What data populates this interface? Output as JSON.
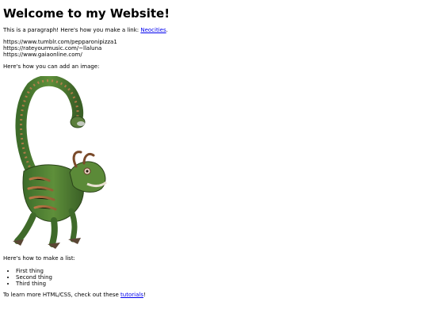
{
  "page": {
    "heading": "Welcome to my Website!",
    "link_intro": "This is a paragraph! Here's how you make a link: ",
    "link_text": "Neocities",
    "link_suffix": ".",
    "urls": [
      "https://www.tumblr.com/pepparonipizza1",
      "https://rateyourmusic.com/~llaluna",
      "https://www.gaiaonline.com/"
    ],
    "image_intro": "Here's how you can add an image:",
    "image": {
      "subject": "green dragon-like creature with long curled neck",
      "icon": "creature-image"
    },
    "list_intro": "Here's how to make a list:",
    "list_items": [
      "First thing",
      "Second thing",
      "Third thing"
    ],
    "tutorial_prefix": "To learn more HTML/CSS, check out these ",
    "tutorial_link": "tutorials",
    "tutorial_suffix": "!"
  },
  "colors": {
    "link": "#0000ee",
    "text": "#000000",
    "background": "#ffffff"
  }
}
